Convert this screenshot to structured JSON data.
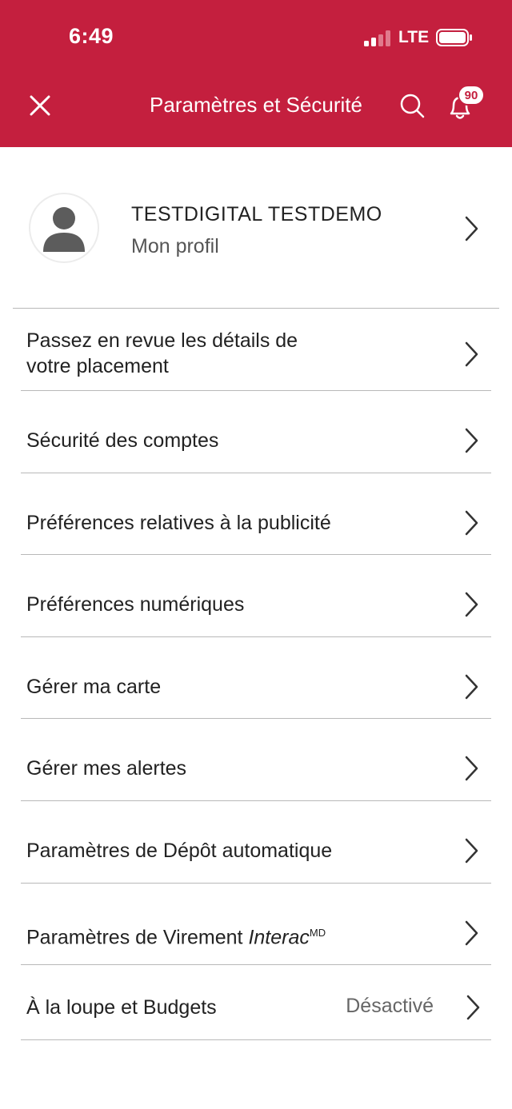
{
  "status_bar": {
    "time": "6:49",
    "network": "LTE"
  },
  "header": {
    "title": "Paramètres et Sécurité",
    "notification_count": "90",
    "background_color": "#c41f3e",
    "icons": [
      "close-icon",
      "search-icon",
      "bell-icon"
    ]
  },
  "profile": {
    "name": "TESTDIGITAL TESTDEMO",
    "subtitle": "Mon profil"
  },
  "menu": {
    "items": [
      {
        "line1": "Passez en revue les détails de",
        "line2": "votre placement"
      },
      {
        "label": "Sécurité des comptes"
      },
      {
        "label": "Préférences relatives à la publicité"
      },
      {
        "label": "Préférences numériques"
      },
      {
        "label": "Gérer ma carte"
      },
      {
        "label": "Gérer mes alertes"
      },
      {
        "label": "Paramètres de Dépôt automatique"
      },
      {
        "label_prefix": "Paramètres de Virement ",
        "label_brand": "Interac",
        "label_sup": "MD"
      },
      {
        "label": "À la loupe et Budgets",
        "value": "Désactivé"
      }
    ]
  }
}
